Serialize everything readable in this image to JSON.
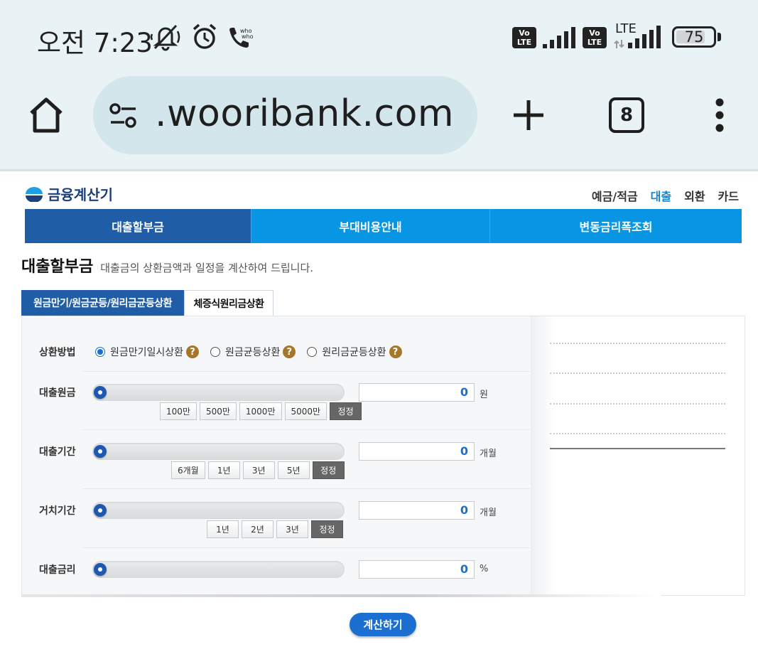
{
  "status_bar": {
    "time": "오전 7:23",
    "battery": "75",
    "network_label": "LTE",
    "volte_badge": "Vo\nLTE",
    "icons": [
      "mute-icon",
      "alarm-icon",
      "whowho-call-icon",
      "volte-icon",
      "signal-icon",
      "volte-icon",
      "lte-signal-icon",
      "battery-icon"
    ]
  },
  "browser": {
    "url": ".wooribank.com",
    "tab_count": "8",
    "icons": [
      "home-icon",
      "site-settings-icon",
      "new-tab-icon",
      "tabs-icon",
      "more-menu-icon"
    ]
  },
  "page": {
    "logo_text": "금융계산기",
    "top_nav": [
      "예금/적금",
      "대출",
      "외환",
      "카드"
    ],
    "top_nav_active": "대출",
    "main_tabs": [
      "대출할부금",
      "부대비용안내",
      "변동금리폭조회"
    ],
    "heading": {
      "title": "대출할부금",
      "description": "대출금의 상환금액과 일정을 계산하여 드립니다."
    },
    "sub_tabs": [
      "원금만기/원금균등/원리금균등상환",
      "체증식원리금상환"
    ],
    "form": {
      "repayment": {
        "label": "상환방법",
        "options": [
          "원금만기일시상환",
          "원금균등상환",
          "원리금균등상환"
        ],
        "selected": "원금만기일시상환",
        "help_glyph": "?"
      },
      "principal": {
        "label": "대출원금",
        "value": "0",
        "unit": "원",
        "quick_buttons": [
          "100만",
          "500만",
          "1000만",
          "5000만"
        ],
        "reset_label": "정정"
      },
      "term": {
        "label": "대출기간",
        "value": "0",
        "unit": "개월",
        "quick_buttons": [
          "6개월",
          "1년",
          "3년",
          "5년"
        ],
        "reset_label": "정정"
      },
      "grace": {
        "label": "거치기간",
        "value": "0",
        "unit": "개월",
        "quick_buttons": [
          "1년",
          "2년",
          "3년"
        ],
        "reset_label": "정정"
      },
      "rate": {
        "label": "대출금리",
        "value": "0",
        "unit": "%"
      }
    },
    "calculate_button": "계산하기"
  },
  "colors": {
    "brand_dark": "#1f5da6",
    "brand_light": "#0895e3",
    "accent": "#1a6fd0",
    "help": "#a6762a"
  }
}
